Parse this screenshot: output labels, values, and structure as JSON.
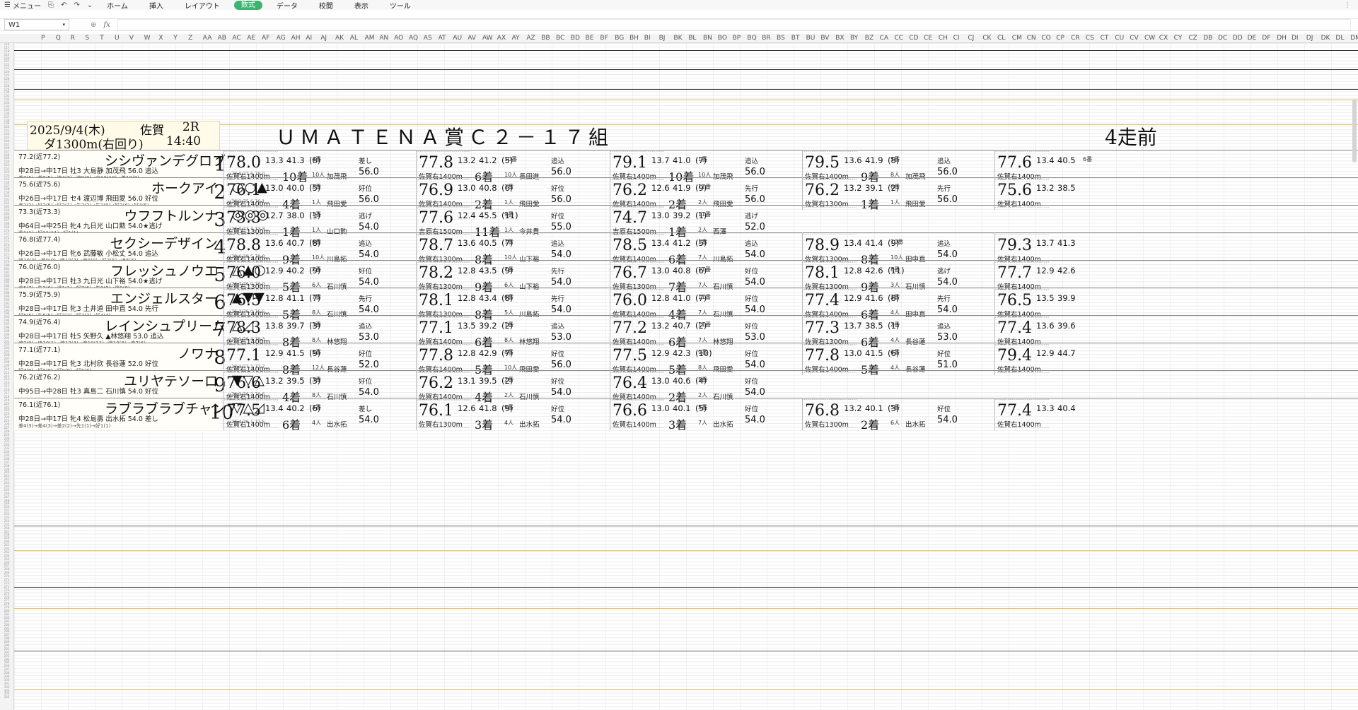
{
  "menu": {
    "label": "メニュー",
    "tabs": [
      "ホーム",
      "挿入",
      "レイアウト",
      "数式",
      "データ",
      "校閲",
      "表示",
      "ツール"
    ],
    "active_tab": 3
  },
  "namebox": "W1",
  "fx": "fx",
  "columns": [
    "P",
    "Q",
    "R",
    "S",
    "T",
    "U",
    "V",
    "W",
    "X",
    "Y",
    "Z",
    "AA",
    "AB",
    "AC",
    "AE",
    "AF",
    "AG",
    "AH",
    "AI",
    "AJ",
    "AK",
    "AL",
    "AM",
    "AN",
    "AO",
    "AQ",
    "AS",
    "AT",
    "AU",
    "AV",
    "AW",
    "AX",
    "AY",
    "AZ",
    "BB",
    "BC",
    "BD",
    "BE",
    "BF",
    "BG",
    "BH",
    "BI",
    "BJ",
    "BK",
    "BL",
    "BN",
    "BO",
    "BP",
    "BQ",
    "BR",
    "BS",
    "BT",
    "BU",
    "BV",
    "BX",
    "BY",
    "BZ",
    "CA",
    "CC",
    "CD",
    "CE",
    "CH",
    "CI",
    "CJ",
    "CK",
    "CL",
    "CM",
    "CN",
    "CO",
    "CP",
    "CR",
    "CS",
    "CT",
    "CU",
    "CV",
    "CW",
    "CX",
    "CY",
    "CZ",
    "DB",
    "DC",
    "DD",
    "DE",
    "DF",
    "DH",
    "DI",
    "DJ",
    "DK",
    "DL",
    "DM",
    "DN"
  ],
  "race": {
    "date": "2025/9/4(木)",
    "venue": "佐賀",
    "race_no": "2R",
    "distance": "ダ1300m(右回り)",
    "time": "14:40"
  },
  "title": "ＵＭＡＴＥＮＡ賞Ｃ２－１７組",
  "section": "4走前",
  "horses": [
    {
      "num": "1",
      "name": "シシヴァンデグロブ",
      "rating": "77.2(近77.2)",
      "detail": "中28日→中17日 牡3 大島静 加茂飛 56.0 追込",
      "foot": "差7(6)→差6(5)→追4(2)→追9(8)→中10(10)→差10(8)",
      "marks": "",
      "sc": "77.9 77.6 78.0",
      "runs": [
        {
          "sp": "78.0",
          "t1": "13.3",
          "t2": "41.3",
          "rk": "(8)",
          "pl": "10着",
          "course": "佐賀右1400m",
          "pos": "4番",
          "heads": "10人",
          "jockey": "加茂飛",
          "wt": "56.0",
          "style": "差し"
        },
        {
          "sp": "77.8",
          "t1": "13.2",
          "t2": "41.2",
          "rk": "(5)",
          "pl": "6着",
          "course": "佐賀右1400m",
          "pos": "10番",
          "heads": "10人",
          "jockey": "長田進",
          "wt": "56.0",
          "style": "追込"
        },
        {
          "sp": "79.1",
          "t1": "13.7",
          "t2": "41.0",
          "rk": "(7)",
          "pl": "10着",
          "course": "佐賀右1400m",
          "pos": "1番",
          "heads": "10人",
          "jockey": "加茂飛",
          "wt": "56.0",
          "style": "追込"
        },
        {
          "sp": "79.5",
          "t1": "13.6",
          "t2": "41.9",
          "rk": "(8)",
          "pl": "9着",
          "course": "佐賀右1400m",
          "pos": "5番",
          "heads": "8人",
          "jockey": "加茂飛",
          "wt": "56.0",
          "style": "追込"
        },
        {
          "sp": "77.6",
          "t1": "13.4",
          "t2": "40.5",
          "rk": "",
          "pl": "",
          "course": "佐賀右1400m",
          "pos": "6番",
          "heads": "",
          "jockey": "",
          "wt": "",
          "style": ""
        }
      ]
    },
    {
      "num": "2",
      "name": "ホークアイ",
      "rating": "75.6(近75.6)",
      "detail": "中26日→中17日 セ4 渡辺博 飛田愛 56.0 好位",
      "foot": "差3(2)→好2(5)→好2(1)→先2(2)→先2(9)→好2(6)→好4(5)",
      "marks": "○○▲",
      "sc": "76.2 75.6 76.1",
      "runs": [
        {
          "sp": "76.1",
          "t1": "13.0",
          "t2": "40.0",
          "rk": "(5)",
          "pl": "4着",
          "course": "佐賀右1400m",
          "pos": "2番",
          "heads": "1人",
          "jockey": "飛田愛",
          "wt": "56.0",
          "style": "好位"
        },
        {
          "sp": "76.9",
          "t1": "13.0",
          "t2": "40.8",
          "rk": "(6)",
          "pl": "2着",
          "course": "佐賀右1400m",
          "pos": "1番",
          "heads": "1人",
          "jockey": "飛田愛",
          "wt": "56.0",
          "style": "好位"
        },
        {
          "sp": "76.2",
          "t1": "12.6",
          "t2": "41.9",
          "rk": "(9)",
          "pl": "2着",
          "course": "佐賀右1400m",
          "pos": "11番",
          "heads": "2人",
          "jockey": "飛田愛",
          "wt": "56.0",
          "style": "先行"
        },
        {
          "sp": "76.2",
          "t1": "13.2",
          "t2": "39.1",
          "rk": "(2)",
          "pl": "1着",
          "course": "佐賀右1300m",
          "pos": "6番",
          "heads": "1人",
          "jockey": "飛田愛",
          "wt": "56.0",
          "style": "先行"
        },
        {
          "sp": "75.6",
          "t1": "13.2",
          "t2": "38.5",
          "rk": "",
          "pl": "",
          "course": "佐賀右1400m",
          "pos": "",
          "heads": "",
          "jockey": "",
          "wt": "",
          "style": ""
        }
      ]
    },
    {
      "num": "3",
      "name": "ウフフトルンナ",
      "rating": "73.3(近73.3)",
      "detail": "中64日→中25日 牝4 九日光 山口勲 54.0★逃げ",
      "foot": "逃1(1)→好11(11)→好1(1)",
      "marks": "◎◎◎",
      "sc": "74.0 73.3 73.3",
      "runs": [
        {
          "sp": "73.3",
          "t1": "12.7",
          "t2": "38.0",
          "rk": "(1)",
          "pl": "1着",
          "course": "佐賀右1300m",
          "pos": "1番",
          "heads": "1人",
          "jockey": "山口勲",
          "wt": "54.0",
          "style": "逃げ"
        },
        {
          "sp": "77.6",
          "t1": "12.4",
          "t2": "45.5",
          "rk": "(11)",
          "pl": "11着",
          "course": "吉原右1500m",
          "pos": "9番",
          "heads": "1人",
          "jockey": "今井貴",
          "wt": "55.0",
          "style": "好位"
        },
        {
          "sp": "74.7",
          "t1": "13.0",
          "t2": "39.2",
          "rk": "(1)",
          "pl": "1着",
          "course": "吉原右1500m",
          "pos": "11番",
          "heads": "2人",
          "jockey": "西澤",
          "wt": "52.0",
          "style": "逃げ"
        }
      ]
    },
    {
      "num": "4",
      "name": "セクシーデザイン",
      "rating": "76.8(近77.4)",
      "detail": "中26日→中17日 牝6 武藤敏 小松丈 54.0 追込",
      "foot": "追10(9)→差9(9)→追10(7)→追9(9)→好7(6)→追6(6)",
      "marks": "",
      "sc": "78.6 78.5 78.8",
      "runs": [
        {
          "sp": "78.8",
          "t1": "13.6",
          "t2": "40.7",
          "rk": "(8)",
          "pl": "9着",
          "course": "佐賀右1400m",
          "pos": "6番",
          "heads": "10人",
          "jockey": "川島拓",
          "wt": "54.0",
          "style": "追込"
        },
        {
          "sp": "78.7",
          "t1": "13.6",
          "t2": "40.5",
          "rk": "(7)",
          "pl": "8着",
          "course": "佐賀右1300m",
          "pos": "7番",
          "heads": "10人",
          "jockey": "山下裕",
          "wt": "54.0",
          "style": "追込"
        },
        {
          "sp": "78.5",
          "t1": "13.4",
          "t2": "41.2",
          "rk": "(5)",
          "pl": "6着",
          "course": "佐賀右1400m",
          "pos": "1番",
          "heads": "7人",
          "jockey": "川島拓",
          "wt": "54.0",
          "style": "追込"
        },
        {
          "sp": "78.9",
          "t1": "13.4",
          "t2": "41.4",
          "rk": "(9)",
          "pl": "8着",
          "course": "佐賀右1300m",
          "pos": "10番",
          "heads": "10人",
          "jockey": "田中直",
          "wt": "54.0",
          "style": "追込"
        },
        {
          "sp": "79.3",
          "t1": "13.7",
          "t2": "41.3",
          "rk": "",
          "pl": "",
          "course": "佐賀右1400m",
          "pos": "",
          "heads": "",
          "jockey": "",
          "wt": "",
          "style": ""
        }
      ]
    },
    {
      "num": "5",
      "name": "フレッシュノウエ",
      "rating": "76.0(近76.0)",
      "detail": "中28日→中17日 牡3 九日光 山下裕 54.0★逃げ",
      "foot": "逃5(7)→先2(6)→逃1(1)→好7(6)→先9(9)→逃9(8)",
      "marks": "△▲○",
      "sc": "76.7 76.0 76.0",
      "runs": [
        {
          "sp": "76.0",
          "t1": "12.9",
          "t2": "40.2",
          "rk": "(9)",
          "pl": "5着",
          "course": "佐賀右1300m",
          "pos": "2番",
          "heads": "6人",
          "jockey": "石川慎",
          "wt": "54.0",
          "style": "好位"
        },
        {
          "sp": "78.2",
          "t1": "12.8",
          "t2": "43.5",
          "rk": "(9)",
          "pl": "9着",
          "course": "佐賀右1300m",
          "pos": "7番",
          "heads": "6人",
          "jockey": "山下裕",
          "wt": "54.0",
          "style": "先行"
        },
        {
          "sp": "76.7",
          "t1": "13.0",
          "t2": "40.8",
          "rk": "(6)",
          "pl": "7着",
          "course": "佐賀右1300m",
          "pos": "11番",
          "heads": "7人",
          "jockey": "石川慎",
          "wt": "54.0",
          "style": "好位"
        },
        {
          "sp": "78.1",
          "t1": "12.8",
          "t2": "42.6",
          "rk": "(11)",
          "pl": "9着",
          "course": "佐賀右1300m",
          "pos": "8番",
          "heads": "3人",
          "jockey": "石川慎",
          "wt": "54.0",
          "style": "逃げ"
        },
        {
          "sp": "77.7",
          "t1": "12.9",
          "t2": "42.6",
          "rk": "",
          "pl": "",
          "course": "佐賀右1400m",
          "pos": "",
          "heads": "",
          "jockey": "",
          "wt": "",
          "style": ""
        }
      ]
    },
    {
      "num": "6",
      "name": "エンジェルスター",
      "rating": "75.9(近75.9)",
      "detail": "中28日→中17日 牝3 土井道 田中直 54.0 先行",
      "foot": "好5(5)→先5(5)→好3(3)→好3(3)→好4(4)",
      "marks": "▲▼▼",
      "sc": "76.2 76.0 76.5",
      "runs": [
        {
          "sp": "76.5",
          "t1": "12.8",
          "t2": "41.1",
          "rk": "(7)",
          "pl": "5着",
          "course": "佐賀右1400m",
          "pos": "7番",
          "heads": "8人",
          "jockey": "石川慎",
          "wt": "54.0",
          "style": "先行"
        },
        {
          "sp": "78.1",
          "t1": "12.8",
          "t2": "43.4",
          "rk": "(8)",
          "pl": "8着",
          "course": "佐賀右1300m",
          "pos": "6番",
          "heads": "5人",
          "jockey": "川島拓",
          "wt": "54.0",
          "style": "先行"
        },
        {
          "sp": "76.0",
          "t1": "12.8",
          "t2": "41.0",
          "rk": "(7)",
          "pl": "4着",
          "course": "佐賀右1400m",
          "pos": "11番",
          "heads": "7人",
          "jockey": "石川慎",
          "wt": "54.0",
          "style": "好位"
        },
        {
          "sp": "77.4",
          "t1": "12.9",
          "t2": "41.6",
          "rk": "(8)",
          "pl": "6着",
          "course": "佐賀右1400m",
          "pos": "2番",
          "heads": "4人",
          "jockey": "田中直",
          "wt": "54.0",
          "style": "先行"
        },
        {
          "sp": "76.5",
          "t1": "13.5",
          "t2": "39.9",
          "rk": "",
          "pl": "",
          "course": "佐賀右1400m",
          "pos": "",
          "heads": "",
          "jockey": "",
          "wt": "",
          "style": ""
        }
      ]
    },
    {
      "num": "7",
      "name": "レインシュプリーム",
      "rating": "74.9(近76.4)",
      "detail": "中28日→中17日 牡5 矢野久 ▲林悠翔 53.0 追込",
      "foot": "追2(0)→追10(1)→追12(4)→追10(11)→追10(8)→追7(6)",
      "marks": "△◿",
      "sc": "77.1 76.4 78.3",
      "runs": [
        {
          "sp": "78.3",
          "t1": "13.8",
          "t2": "39.7",
          "rk": "(3)",
          "pl": "8着",
          "course": "佐賀右1400m",
          "pos": "3番",
          "heads": "8人",
          "jockey": "林悠翔",
          "wt": "53.0",
          "style": "追込"
        },
        {
          "sp": "77.1",
          "t1": "13.5",
          "t2": "39.2",
          "rk": "(2)",
          "pl": "6着",
          "course": "佐賀右1400m",
          "pos": "1番",
          "heads": "8人",
          "jockey": "林悠翔",
          "wt": "53.0",
          "style": "追込"
        },
        {
          "sp": "77.2",
          "t1": "13.2",
          "t2": "40.7",
          "rk": "(2)",
          "pl": "6着",
          "course": "佐賀右1400m",
          "pos": "11番",
          "heads": "7人",
          "jockey": "林悠翔",
          "wt": "53.0",
          "style": "好位"
        },
        {
          "sp": "77.3",
          "t1": "13.7",
          "t2": "38.5",
          "rk": "(1)",
          "pl": "6着",
          "course": "佐賀右1300m",
          "pos": "2番",
          "heads": "4人",
          "jockey": "長谷蓮",
          "wt": "53.0",
          "style": "追込"
        },
        {
          "sp": "77.4",
          "t1": "13.6",
          "t2": "39.6",
          "rk": "",
          "pl": "",
          "course": "佐賀右1400m",
          "pos": "",
          "heads": "",
          "jockey": "",
          "wt": "",
          "style": ""
        }
      ]
    },
    {
      "num": "8",
      "name": "ノワナ",
      "rating": "77.1(近77.1)",
      "detail": "中28日→中17日 牝3 北村欣 長谷蓮 52.0 好位",
      "foot": "好7(9)→好9(9)→好9(9)→好6(6)",
      "marks": "",
      "sc": "77.3 77.1 77.7",
      "runs": [
        {
          "sp": "77.1",
          "t1": "12.9",
          "t2": "41.5",
          "rk": "(9)",
          "pl": "8着",
          "course": "佐賀右1400m",
          "pos": "5番",
          "heads": "12人",
          "jockey": "長谷蓮",
          "wt": "52.0",
          "style": "好位"
        },
        {
          "sp": "77.8",
          "t1": "12.8",
          "t2": "42.9",
          "rk": "(7)",
          "pl": "5着",
          "course": "佐賀右1400m",
          "pos": "8番",
          "heads": "10人",
          "jockey": "飛田愛",
          "wt": "56.0",
          "style": "好位"
        },
        {
          "sp": "77.5",
          "t1": "12.9",
          "t2": "42.3",
          "rk": "(10)",
          "pl": "5着",
          "course": "佐賀右1400m",
          "pos": "9番",
          "heads": "8人",
          "jockey": "飛田愛",
          "wt": "54.0",
          "style": "好位"
        },
        {
          "sp": "77.8",
          "t1": "13.0",
          "t2": "41.5",
          "rk": "(6)",
          "pl": "5着",
          "course": "佐賀右1400m",
          "pos": "6番",
          "heads": "4人",
          "jockey": "長谷蓮",
          "wt": "51.0",
          "style": "好位"
        },
        {
          "sp": "79.4",
          "t1": "12.9",
          "t2": "44.7",
          "rk": "",
          "pl": "",
          "course": "佐賀右1400m",
          "pos": "",
          "heads": "",
          "jockey": "",
          "wt": "",
          "style": ""
        }
      ]
    },
    {
      "num": "9",
      "name": "ユリヤテソーロ",
      "rating": "76.2(近76.2)",
      "detail": "中95日→中28日 牡3 真島二 石川慎 54.0 好位",
      "foot": "",
      "marks": "▼▽△",
      "sc": "76.3 76.2 76.6",
      "runs": [
        {
          "sp": "76.6",
          "t1": "13.2",
          "t2": "39.5",
          "rk": "(3)",
          "pl": "4着",
          "course": "佐賀右1400m",
          "pos": "3番",
          "heads": "8人",
          "jockey": "石川慎",
          "wt": "54.0",
          "style": "好位"
        },
        {
          "sp": "76.2",
          "t1": "13.1",
          "t2": "39.5",
          "rk": "(2)",
          "pl": "4着",
          "course": "佐賀右1400m",
          "pos": "2番",
          "heads": "2人",
          "jockey": "石川慎",
          "wt": "54.0",
          "style": "好位"
        },
        {
          "sp": "76.4",
          "t1": "13.0",
          "t2": "40.6",
          "rk": "(4)",
          "pl": "2着",
          "course": "佐賀右1400m",
          "pos": "5番",
          "heads": "2人",
          "jockey": "石川慎",
          "wt": "54.0",
          "style": "好位"
        }
      ]
    },
    {
      "num": "10",
      "name": "ラブラブラブチャン",
      "rating": "76.1(近76.1)",
      "detail": "中28日→中17日 牝4 松島壽 出水拓 54.0 差し",
      "foot": "差4(3)→差4(3)→差2(2)→先1(1)→好1(1)",
      "marks": "▽△◿",
      "sc": "76.4 76.1 77.5",
      "runs": [
        {
          "sp": "77.5",
          "t1": "13.4",
          "t2": "40.2",
          "rk": "(6)",
          "pl": "6着",
          "course": "佐賀右1400m",
          "pos": "3番",
          "heads": "4人",
          "jockey": "出水拓",
          "wt": "54.0",
          "style": "差し"
        },
        {
          "sp": "76.1",
          "t1": "12.6",
          "t2": "41.8",
          "rk": "(9)",
          "pl": "3着",
          "course": "佐賀右1300m",
          "pos": "9番",
          "heads": "4人",
          "jockey": "出水拓",
          "wt": "54.0",
          "style": "好位"
        },
        {
          "sp": "76.6",
          "t1": "13.0",
          "t2": "40.1",
          "rk": "(5)",
          "pl": "3着",
          "course": "佐賀右1400m",
          "pos": "5番",
          "heads": "7人",
          "jockey": "出水拓",
          "wt": "54.0",
          "style": "好位"
        },
        {
          "sp": "76.8",
          "t1": "13.2",
          "t2": "40.1",
          "rk": "(3)",
          "pl": "2着",
          "course": "佐賀右1300m",
          "pos": "5番",
          "heads": "6人",
          "jockey": "出水拓",
          "wt": "54.0",
          "style": "好位"
        },
        {
          "sp": "77.4",
          "t1": "13.3",
          "t2": "40.4",
          "rk": "",
          "pl": "",
          "course": "佐賀右1400m",
          "pos": "",
          "heads": "",
          "jockey": "",
          "wt": "",
          "style": ""
        }
      ]
    }
  ]
}
